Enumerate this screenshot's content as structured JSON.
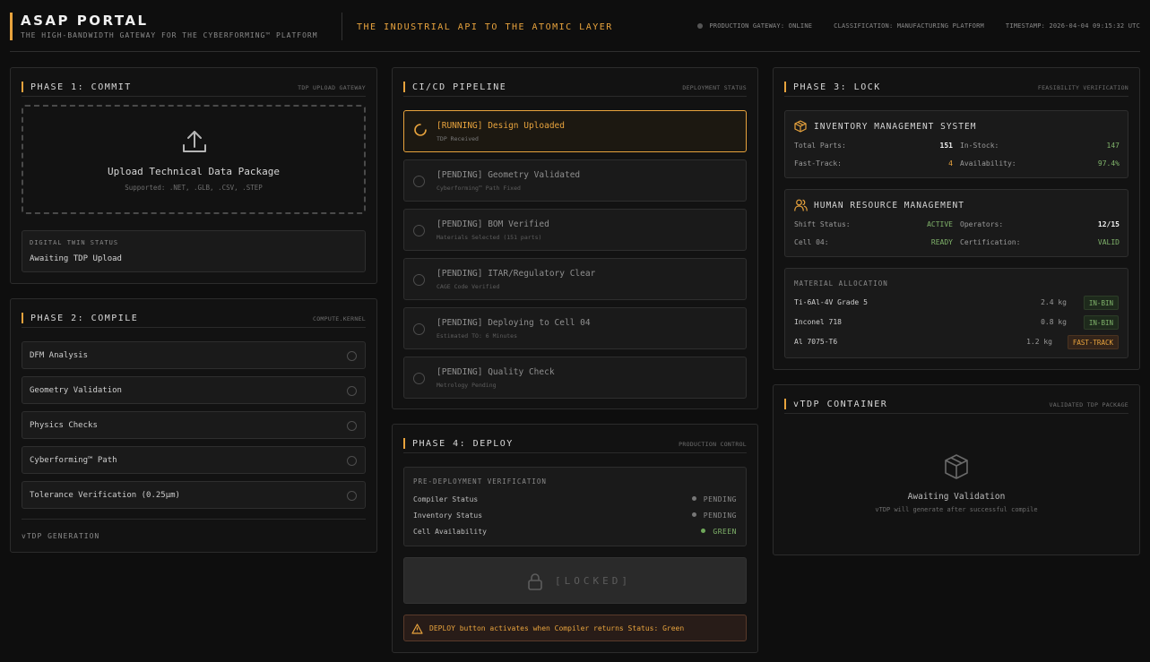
{
  "header": {
    "title": "ASAP PORTAL",
    "subtitle": "THE HIGH-BANDWIDTH GATEWAY FOR THE CYBERFORMING™ PLATFORM",
    "tagline": "THE INDUSTRIAL API TO THE ATOMIC LAYER",
    "gateway": "PRODUCTION GATEWAY: ONLINE",
    "classification": "CLASSIFICATION: MANUFACTURING PLATFORM",
    "timestamp": "TIMESTAMP: 2026-04-04 09:15:32 UTC"
  },
  "phase1": {
    "title": "PHASE 1: COMMIT",
    "tag": "TDP UPLOAD GATEWAY",
    "upload_title": "Upload Technical Data Package",
    "upload_sub": "Supported: .NET, .GLB, .CSV, .STEP",
    "twin_label": "DIGITAL TWIN STATUS",
    "twin_value": "Awaiting TDP Upload"
  },
  "phase2": {
    "title": "PHASE 2: COMPILE",
    "tag": "COMPUTE.KERNEL",
    "tasks": [
      "DFM Analysis",
      "Geometry Validation",
      "Physics Checks",
      "Cyberforming™ Path",
      "Tolerance Verification (0.25µm)"
    ],
    "footer": "vTDP GENERATION"
  },
  "pipeline": {
    "title": "CI/CD PIPELINE",
    "tag": "DEPLOYMENT STATUS",
    "steps": [
      {
        "title": "[RUNNING] Design Uploaded",
        "sub": "TDP Received",
        "state": "running"
      },
      {
        "title": "[PENDING] Geometry Validated",
        "sub": "Cyberforming™ Path Fixed",
        "state": "pending"
      },
      {
        "title": "[PENDING] BOM Verified",
        "sub": "Materials Selected (151 parts)",
        "state": "pending"
      },
      {
        "title": "[PENDING] ITAR/Regulatory Clear",
        "sub": "CAGE Code Verified",
        "state": "pending"
      },
      {
        "title": "[PENDING] Deploying to Cell 04",
        "sub": "Estimated TO: 6 Minutes",
        "state": "pending"
      },
      {
        "title": "[PENDING] Quality Check",
        "sub": "Metrology Pending",
        "state": "pending"
      }
    ]
  },
  "phase4": {
    "title": "PHASE 4: DEPLOY",
    "tag": "PRODUCTION CONTROL",
    "verification_title": "PRE-DEPLOYMENT VERIFICATION",
    "rows": [
      {
        "label": "Compiler Status",
        "value": "PENDING"
      },
      {
        "label": "Inventory Status",
        "value": "PENDING"
      },
      {
        "label": "Cell Availability",
        "value": "GREEN"
      }
    ],
    "locked_label": "[LOCKED]",
    "warning": "DEPLOY button activates when Compiler returns Status: Green"
  },
  "phase3": {
    "title": "PHASE 3: LOCK",
    "tag": "FEASIBILITY VERIFICATION",
    "inventory": {
      "title": "INVENTORY MANAGEMENT SYSTEM",
      "total_parts_label": "Total Parts:",
      "total_parts": "151",
      "in_stock_label": "In-Stock:",
      "in_stock": "147",
      "fast_track_label": "Fast-Track:",
      "fast_track": "4",
      "availability_label": "Availability:",
      "availability": "97.4%"
    },
    "hr": {
      "title": "HUMAN RESOURCE MANAGEMENT",
      "shift_label": "Shift Status:",
      "shift": "ACTIVE",
      "operators_label": "Operators:",
      "operators": "12/15",
      "cell_label": "Cell 04:",
      "cell": "READY",
      "cert_label": "Certification:",
      "cert": "VALID"
    },
    "materials": {
      "title": "MATERIAL ALLOCATION",
      "rows": [
        {
          "name": "Ti-6Al-4V Grade 5",
          "weight": "2.4 kg",
          "badge": "IN-BIN"
        },
        {
          "name": "Inconel 718",
          "weight": "0.8 kg",
          "badge": "IN-BIN"
        },
        {
          "name": "Al 7075-T6",
          "weight": "1.2 kg",
          "badge": "FAST-TRACK"
        }
      ]
    }
  },
  "vtdp": {
    "title": "vTDP CONTAINER",
    "tag": "VALIDATED TDP PACKAGE",
    "main": "Awaiting Validation",
    "sub": "vTDP will generate after successful compile"
  },
  "colors": {
    "accent": "#e8a33d",
    "success": "#7fb26a",
    "background": "#0e0e0e"
  }
}
